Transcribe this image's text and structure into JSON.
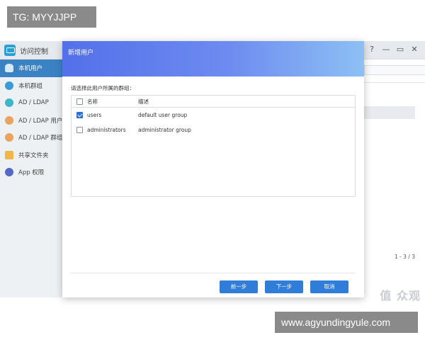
{
  "watermark_top": "TG: MYYJJPP",
  "watermark_bottom": "www.agyundingyule.com",
  "watermark_zhi": "值 众观",
  "app": {
    "title": "访问控制",
    "controls": {
      "help": "?",
      "minimize": "—",
      "maximize": "▭",
      "close": "✕"
    }
  },
  "sidebar": {
    "items": [
      {
        "label": "本机用户",
        "icon": "user-icon",
        "color": "#ffffff"
      },
      {
        "label": "本机群组",
        "icon": "group-icon",
        "color": "#3a9bd8"
      },
      {
        "label": "AD / LDAP",
        "icon": "ldap-icon",
        "color": "#3fb6c8"
      },
      {
        "label": "AD / LDAP 用户",
        "icon": "ldap-user-icon",
        "color": "#e8a45c"
      },
      {
        "label": "AD / LDAP 群组",
        "icon": "ldap-group-icon",
        "color": "#e8a45c"
      },
      {
        "label": "共享文件夹",
        "icon": "folder-icon",
        "color": "#f0b64a"
      },
      {
        "label": "App 权限",
        "icon": "app-permission-icon",
        "color": "#5568c9"
      }
    ]
  },
  "pager": "1 - 3 / 3",
  "dialog": {
    "title": "新增用户",
    "instruction": "请选择此用户所属的群组：",
    "columns": {
      "name": "名称",
      "description": "描述"
    },
    "rows": [
      {
        "name": "users",
        "description": "default user group",
        "checked": true
      },
      {
        "name": "administrators",
        "description": "administrator group",
        "checked": false
      }
    ],
    "buttons": {
      "prev": "前一步",
      "next": "下一步",
      "cancel": "取消"
    }
  },
  "colors": {
    "accent": "#2f7dd8",
    "sidebar_active": "#3b82c4",
    "header_start": "#5470ea",
    "header_end": "#8dc0f4"
  }
}
